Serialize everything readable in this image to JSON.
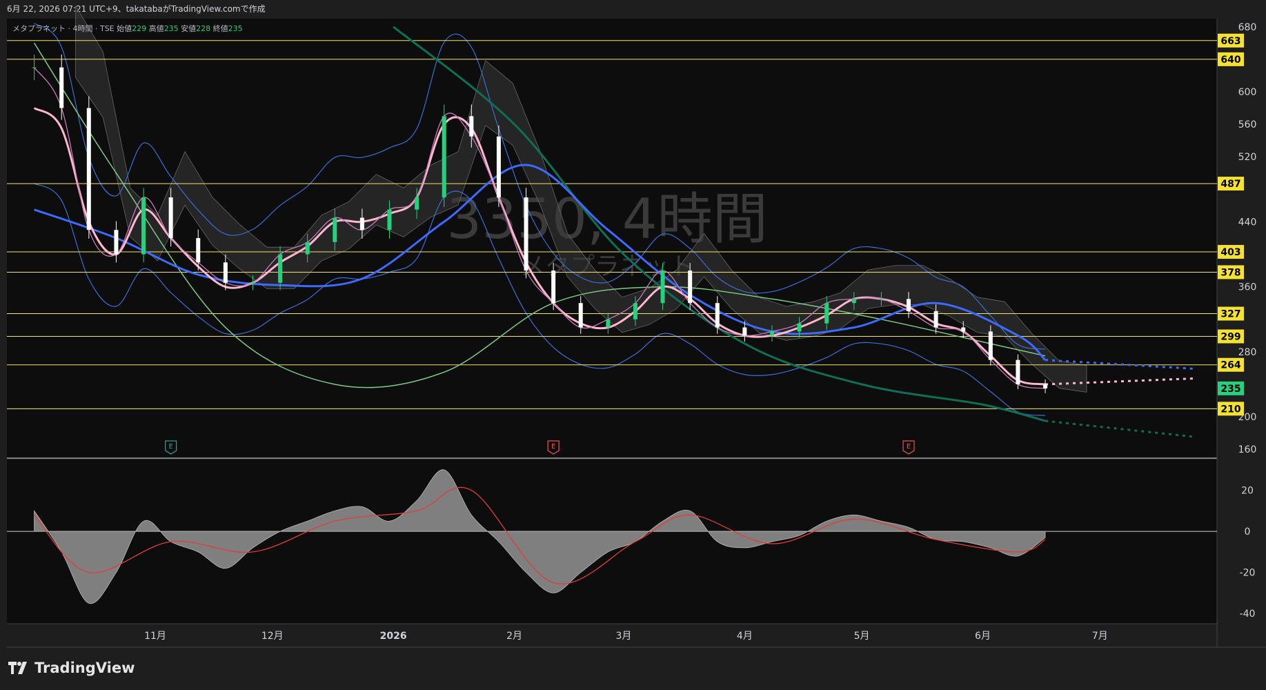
{
  "header": {
    "text": "6月 22, 2026 07:21 UTC+9、takatabaがTradingView.comで作成"
  },
  "legend": {
    "symbol": "メタプラネット · 4時間 · TSE",
    "open_label": "始値",
    "open": "229",
    "high_label": "高値",
    "high": "235",
    "low_label": "安値",
    "low": "228",
    "close_label": "終値",
    "close": "235"
  },
  "watermark": {
    "symbol": "3350, 4時間",
    "name": "メタプラネット"
  },
  "brand": {
    "name": "TradingView"
  },
  "colors": {
    "background": "#0d0d0d",
    "candle_up": "#26d07c",
    "candle_down": "#ffffff",
    "sma_fast": "#ffb6d0",
    "sma_mid": "#c77dba",
    "sma_slow": "#3d6bff",
    "sma_long": "#7dcc86",
    "sma_very_long": "#0f6f55",
    "bollinger": "#3a6fd9",
    "cloud": "#3a3a3a",
    "macd_hist": "#8c8c8c",
    "macd_signal": "#e03c3c",
    "hline": "#f5e56b",
    "badge_bg": "#f5e131",
    "badge_last": "#26d07c"
  },
  "earnings_marker": "E",
  "chart_data": [
    {
      "type": "line",
      "title": "",
      "ylim": [
        150,
        690
      ],
      "y_ticks": [
        160,
        200,
        280,
        360,
        440,
        520,
        560,
        600,
        680
      ],
      "x_ticks": [
        "11月",
        "12月",
        "2026",
        "2月",
        "3月",
        "4月",
        "5月",
        "6月",
        "7月"
      ],
      "horizontal_levels": [
        663,
        640,
        487,
        403,
        378,
        327,
        299,
        264,
        210
      ],
      "last_price": 235,
      "grid": false,
      "series": [
        {
          "role": "close",
          "x": [
            "2025-10-01",
            "2025-10-08",
            "2025-10-15",
            "2025-10-22",
            "2025-10-29",
            "2025-11-05",
            "2025-11-12",
            "2025-11-19",
            "2025-11-26",
            "2025-12-03",
            "2025-12-10",
            "2025-12-17",
            "2025-12-24",
            "2025-12-31",
            "2026-01-07",
            "2026-01-14",
            "2026-01-21",
            "2026-01-28",
            "2026-02-04",
            "2026-02-11",
            "2026-02-18",
            "2026-02-25",
            "2026-03-04",
            "2026-03-11",
            "2026-03-18",
            "2026-03-25",
            "2026-04-01",
            "2026-04-08",
            "2026-04-15",
            "2026-04-22",
            "2026-04-29",
            "2026-05-06",
            "2026-05-13",
            "2026-05-20",
            "2026-05-27",
            "2026-06-03",
            "2026-06-10",
            "2026-06-17"
          ],
          "y": [
            630,
            580,
            430,
            400,
            470,
            420,
            390,
            365,
            365,
            400,
            415,
            445,
            430,
            455,
            470,
            570,
            545,
            470,
            380,
            340,
            310,
            320,
            340,
            380,
            340,
            310,
            300,
            305,
            315,
            340,
            345,
            345,
            330,
            310,
            305,
            270,
            240,
            235
          ]
        },
        {
          "role": "sma_fast",
          "x": [
            "2025-10-01",
            "2025-10-08",
            "2025-10-15",
            "2025-10-22",
            "2025-10-29",
            "2025-11-05",
            "2025-11-12",
            "2025-11-19",
            "2025-11-26",
            "2025-12-03",
            "2025-12-10",
            "2025-12-17",
            "2025-12-24",
            "2025-12-31",
            "2026-01-07",
            "2026-01-14",
            "2026-01-21",
            "2026-01-28",
            "2026-02-04",
            "2026-02-11",
            "2026-02-18",
            "2026-02-25",
            "2026-03-04",
            "2026-03-11",
            "2026-03-18",
            "2026-03-25",
            "2026-04-01",
            "2026-04-08",
            "2026-04-15",
            "2026-04-22",
            "2026-04-29",
            "2026-05-06",
            "2026-05-13",
            "2026-05-20",
            "2026-05-27",
            "2026-06-03",
            "2026-06-10",
            "2026-06-17"
          ],
          "y": [
            580,
            555,
            440,
            400,
            455,
            420,
            385,
            360,
            365,
            390,
            410,
            440,
            440,
            450,
            470,
            560,
            555,
            470,
            390,
            340,
            315,
            310,
            330,
            360,
            345,
            315,
            300,
            300,
            310,
            325,
            345,
            345,
            335,
            315,
            305,
            275,
            245,
            240
          ]
        },
        {
          "role": "sma_slow",
          "x": [
            "2025-10-01",
            "2025-10-22",
            "2025-11-12",
            "2025-12-03",
            "2025-12-24",
            "2026-01-14",
            "2026-02-04",
            "2026-02-25",
            "2026-03-18",
            "2026-04-08",
            "2026-04-29",
            "2026-05-20",
            "2026-06-10",
            "2026-06-17"
          ],
          "y": [
            455,
            420,
            375,
            362,
            370,
            440,
            510,
            430,
            350,
            305,
            310,
            340,
            300,
            270
          ]
        },
        {
          "role": "sma_long",
          "x": [
            "2025-10-01",
            "2025-10-22",
            "2025-11-19",
            "2025-12-17",
            "2026-01-14",
            "2026-02-11",
            "2026-03-11",
            "2026-04-08",
            "2026-05-06",
            "2026-06-03",
            "2026-06-17"
          ],
          "y": [
            660,
            500,
            310,
            240,
            255,
            340,
            360,
            345,
            320,
            290,
            275
          ]
        },
        {
          "role": "sma_very_long",
          "x": [
            "2026-01-01",
            "2026-02-01",
            "2026-03-01",
            "2026-04-01",
            "2026-05-01",
            "2026-06-01",
            "2026-06-17"
          ],
          "y": [
            680,
            560,
            400,
            290,
            240,
            215,
            195
          ]
        }
      ]
    },
    {
      "type": "area",
      "title": "",
      "ylim": [
        -45,
        35
      ],
      "y_ticks": [
        20,
        0,
        -20,
        -40
      ],
      "zero_line": true,
      "series": [
        {
          "role": "macd_histogram",
          "x": [
            "2025-10-01",
            "2025-10-08",
            "2025-10-15",
            "2025-10-22",
            "2025-10-29",
            "2025-11-05",
            "2025-11-12",
            "2025-11-19",
            "2025-11-26",
            "2025-12-03",
            "2025-12-10",
            "2025-12-17",
            "2025-12-24",
            "2025-12-31",
            "2026-01-07",
            "2026-01-14",
            "2026-01-21",
            "2026-01-28",
            "2026-02-04",
            "2026-02-11",
            "2026-02-18",
            "2026-02-25",
            "2026-03-04",
            "2026-03-11",
            "2026-03-18",
            "2026-03-25",
            "2026-04-01",
            "2026-04-08",
            "2026-04-15",
            "2026-04-22",
            "2026-04-29",
            "2026-05-06",
            "2026-05-13",
            "2026-05-20",
            "2026-05-27",
            "2026-06-03",
            "2026-06-10",
            "2026-06-17"
          ],
          "y": [
            10,
            -10,
            -35,
            -20,
            5,
            -5,
            -10,
            -18,
            -8,
            0,
            5,
            10,
            12,
            5,
            15,
            30,
            8,
            -5,
            -20,
            -30,
            -20,
            -10,
            -5,
            5,
            10,
            -5,
            -8,
            -5,
            -2,
            5,
            8,
            5,
            2,
            -4,
            -5,
            -8,
            -12,
            -3
          ]
        },
        {
          "role": "macd_signal",
          "x": [
            "2025-10-01",
            "2025-10-15",
            "2025-11-05",
            "2025-11-26",
            "2025-12-17",
            "2026-01-07",
            "2026-01-21",
            "2026-02-11",
            "2026-03-04",
            "2026-03-18",
            "2026-04-08",
            "2026-04-29",
            "2026-05-20",
            "2026-06-10",
            "2026-06-17"
          ],
          "y": [
            8,
            -20,
            -5,
            -10,
            5,
            10,
            20,
            -25,
            -5,
            8,
            -6,
            6,
            -4,
            -10,
            -4
          ]
        }
      ]
    }
  ]
}
